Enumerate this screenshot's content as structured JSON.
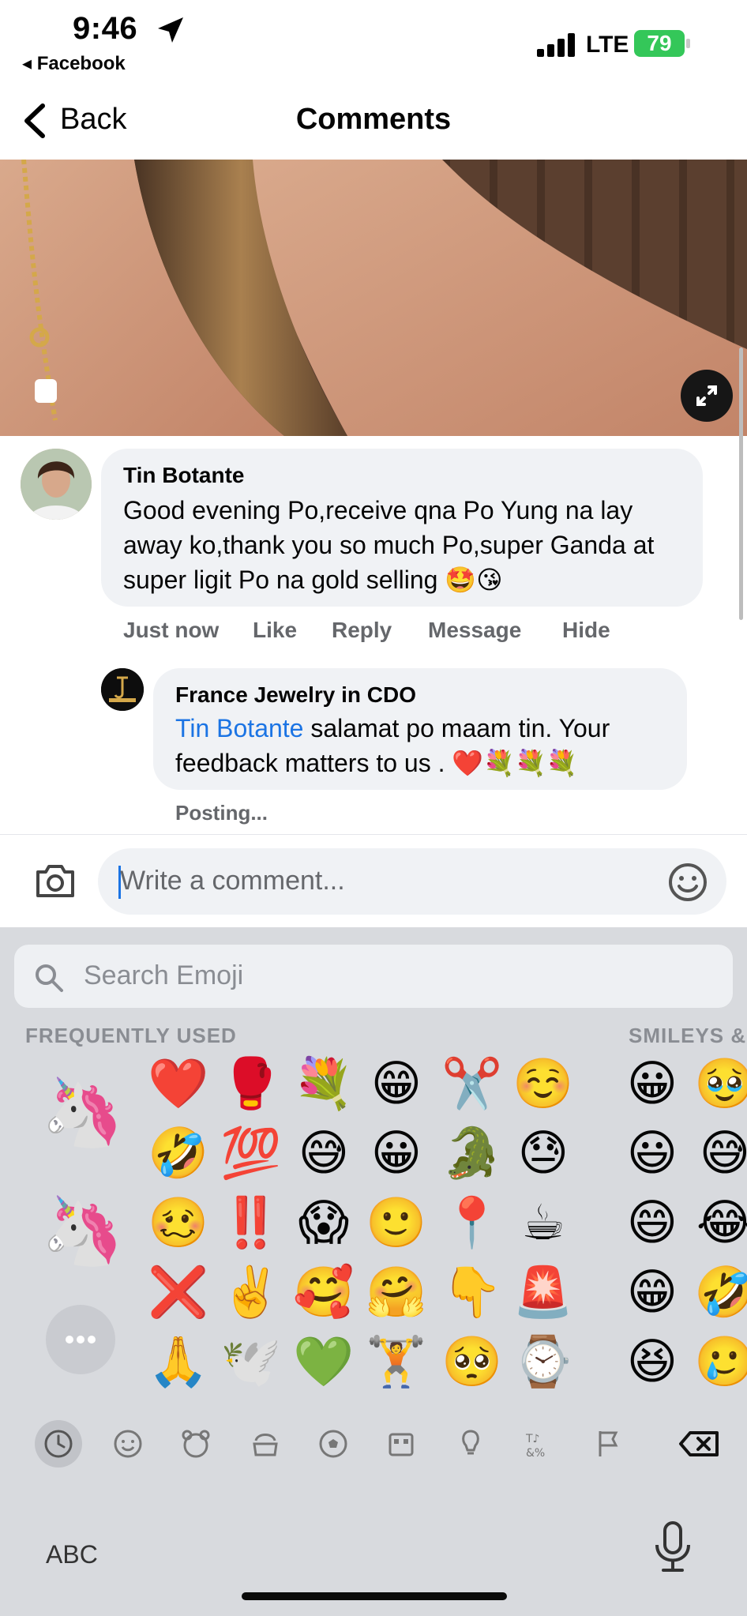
{
  "status_bar": {
    "time": "9:46",
    "back_app": "◂ Facebook",
    "network": "LTE",
    "battery": "79"
  },
  "nav": {
    "back_label": "Back",
    "title": "Comments"
  },
  "comments": [
    {
      "author": "Tin Botante",
      "text": "Good evening Po,receive qna Po Yung na lay away ko,thank you so much Po,super Ganda at super ligit Po na gold selling 🤩😘",
      "meta": [
        "Just now",
        "Like",
        "Reply",
        "Message",
        "Hide"
      ]
    },
    {
      "author": "France Jewelry in CDO",
      "mention": "Tin Botante",
      "text": " salamat po maam tin. Your feedback matters to us . ❤️💐💐💐",
      "status": "Posting..."
    }
  ],
  "composer": {
    "placeholder": "Write a comment..."
  },
  "emoji_keyboard": {
    "search_placeholder": "Search Emoji",
    "section_frequent": "FREQUENTLY USED",
    "section_smileys": "SMILEYS &",
    "memoji": [
      "🦄",
      "🦄"
    ],
    "frequent_rows": [
      [
        "❤️",
        "🥊",
        "💐",
        "😁",
        "✂️",
        "☺️"
      ],
      [
        "🤣",
        "💯",
        "😅",
        "😀",
        "🐊",
        "😓"
      ],
      [
        "🥴",
        "‼️",
        "😱",
        "🙂",
        "📍",
        "☕"
      ],
      [
        "❌",
        "✌️",
        "🥰",
        "🤗",
        "👇",
        "🚨"
      ],
      [
        "🙏",
        "🕊️",
        "💚",
        "🏋️",
        "🥺",
        "⌚"
      ]
    ],
    "smiley_rows": [
      [
        "😀",
        "🥹"
      ],
      [
        "😃",
        "😅"
      ],
      [
        "😄",
        "😂"
      ],
      [
        "😁",
        "🤣"
      ],
      [
        "😆",
        "🥲"
      ]
    ],
    "abc_label": "ABC"
  }
}
